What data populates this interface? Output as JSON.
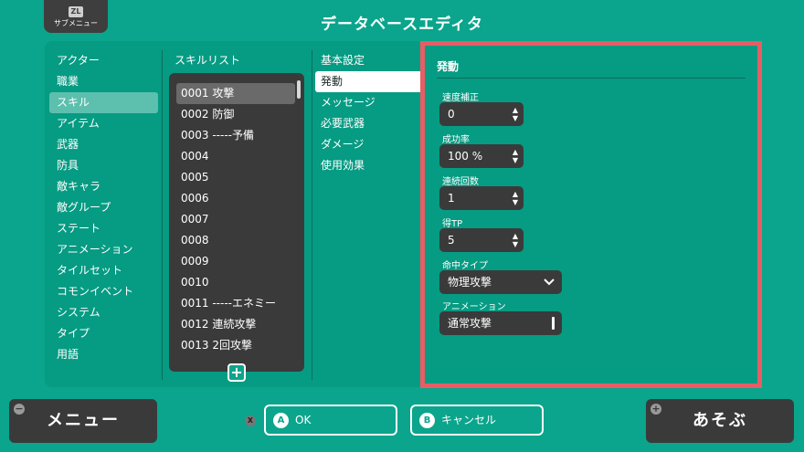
{
  "header": {
    "submenu_badge": "ZL",
    "submenu_label": "サブメニュー",
    "title": "データベースエディタ"
  },
  "categories": {
    "items": [
      "アクター",
      "職業",
      "スキル",
      "アイテム",
      "武器",
      "防具",
      "敵キャラ",
      "敵グループ",
      "ステート",
      "アニメーション",
      "タイルセット",
      "コモンイベント",
      "システム",
      "タイプ",
      "用語"
    ],
    "selected": "スキル"
  },
  "skill_list": {
    "title": "スキルリスト",
    "items": [
      "0001 攻撃",
      "0002 防御",
      "0003 -----予備",
      "0004",
      "0005",
      "0006",
      "0007",
      "0008",
      "0009",
      "0010",
      "0011 -----エネミー",
      "0012 連続攻撃",
      "0013 2回攻撃"
    ],
    "selected": "0001 攻撃",
    "add_label": "+"
  },
  "tabs": {
    "items": [
      "基本設定",
      "発動",
      "メッセージ",
      "必要武器",
      "ダメージ",
      "使用効果"
    ],
    "selected": "発動"
  },
  "detail": {
    "title": "発動",
    "speed": {
      "label": "速度補正",
      "value": "0"
    },
    "success": {
      "label": "成功率",
      "value": "100 %"
    },
    "repeats": {
      "label": "連続回数",
      "value": "1"
    },
    "tp_gain": {
      "label": "得TP",
      "value": "5"
    },
    "hit_type": {
      "label": "命中タイプ",
      "value": "物理攻撃"
    },
    "animation": {
      "label": "アニメーション",
      "value": "通常攻撃"
    }
  },
  "footer": {
    "menu_label": "メニュー",
    "menu_badge": "−",
    "x_badge": "X",
    "ok_badge": "A",
    "ok_label": "OK",
    "cancel_badge": "B",
    "cancel_label": "キャンセル",
    "play_label": "あそぶ",
    "play_badge": "+"
  },
  "colors": {
    "background": "#0aa58c",
    "panel": "#069b83",
    "dark_control": "#3a3a3a",
    "highlight_border": "#e85d64",
    "selected_category": "#5dbfae"
  }
}
